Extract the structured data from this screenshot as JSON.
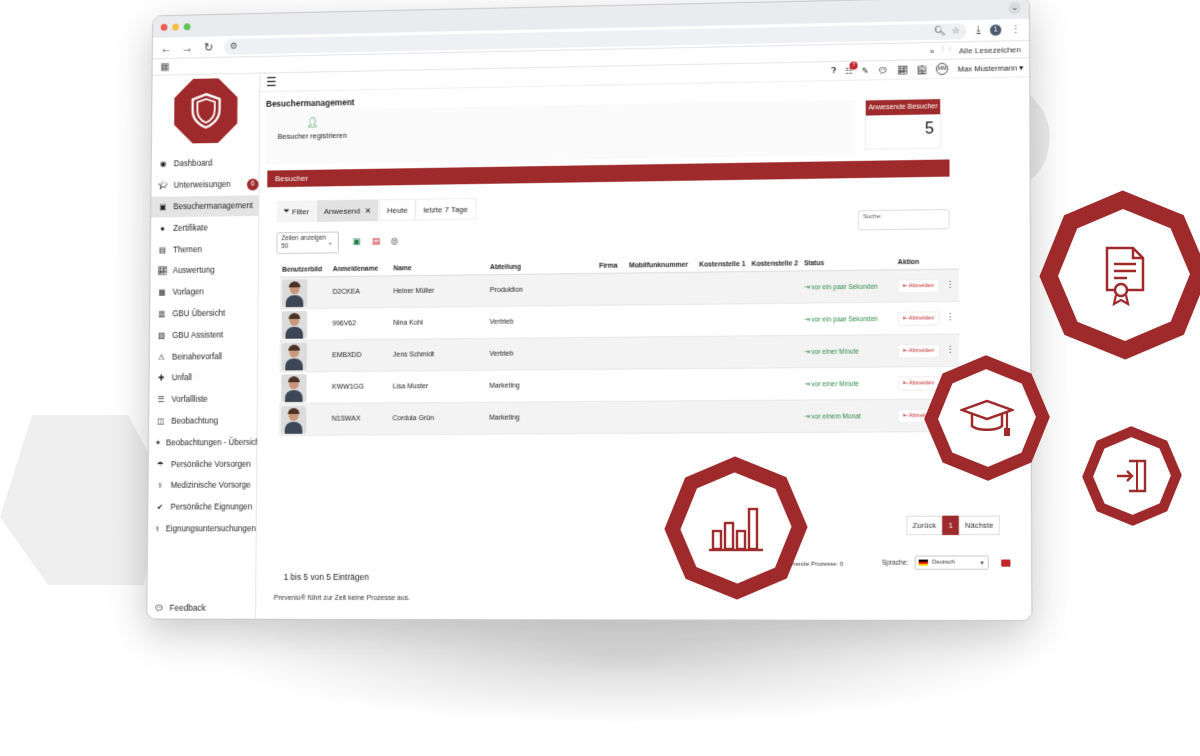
{
  "browser": {
    "bookmarks_label": "Alle Lesezeichen",
    "profile_initial": "1"
  },
  "topbar": {
    "notification_count": "7",
    "user_initials": "MM",
    "user_name": "Max Mustermann"
  },
  "sidebar": {
    "items": [
      {
        "label": "Dashboard",
        "icon": "dashboard-icon"
      },
      {
        "label": "Unterweisungen",
        "icon": "graduation-icon",
        "badge": "6"
      },
      {
        "label": "Besuchermanagement",
        "icon": "visitor-icon",
        "active": true
      },
      {
        "label": "Zertifikate",
        "icon": "certificate-icon"
      },
      {
        "label": "Themen",
        "icon": "topics-icon"
      },
      {
        "label": "Auswertung",
        "icon": "chart-icon"
      },
      {
        "label": "Vorlagen",
        "icon": "template-icon"
      },
      {
        "label": "GBU Übersicht",
        "icon": "gbu-overview-icon"
      },
      {
        "label": "GBU Assistent",
        "icon": "gbu-assistant-icon"
      },
      {
        "label": "Beinahevorfall",
        "icon": "near-miss-icon"
      },
      {
        "label": "Unfall",
        "icon": "accident-icon"
      },
      {
        "label": "Vorfallliste",
        "icon": "incident-list-icon"
      },
      {
        "label": "Beobachtung",
        "icon": "observation-icon"
      },
      {
        "label": "Beobachtungen - Übersicht",
        "icon": "observation-overview-icon"
      },
      {
        "label": "Persönliche Vorsorgen",
        "icon": "personal-care-icon"
      },
      {
        "label": "Medizinische Vorsorge",
        "icon": "medical-icon"
      },
      {
        "label": "Persönliche Eignungen",
        "icon": "aptitude-icon"
      },
      {
        "label": "Eignungsuntersuchungen",
        "icon": "stethoscope-icon"
      }
    ],
    "feedback_label": "Feedback"
  },
  "page": {
    "title": "Besuchermanagement",
    "register_label": "Besucher registrieren",
    "present_label": "Anwesende Besucher",
    "present_count": "5",
    "section_label": "Besucher"
  },
  "filters": {
    "filter_label": "Filter",
    "options": [
      "Anwesend",
      "Heute",
      "letzte 7 Tage"
    ],
    "active": "Anwesend",
    "search_placeholder": "Suche:"
  },
  "rows_control": {
    "label": "Zeilen anzeigen",
    "value": "50"
  },
  "table": {
    "headers": [
      "Benutzerbild",
      "Anmeldename",
      "Name",
      "Abteilung",
      "Firma",
      "Mobilfunknummer",
      "Kostenstelle 1",
      "Kostenstelle 2",
      "Status",
      "Aktion"
    ],
    "rows": [
      {
        "login": "D2CKEA",
        "name": "Heiner Müller",
        "department": "Produktion",
        "status": "vor ein paar Sekunden",
        "action": "Abmelden"
      },
      {
        "login": "996V62",
        "name": "Nina Kohl",
        "department": "Vertrieb",
        "status": "vor ein paar Sekunden",
        "action": "Abmelden"
      },
      {
        "login": "EMBXDD",
        "name": "Jens Schmidt",
        "department": "Vertrieb",
        "status": "vor einer Minute",
        "action": "Abmelden"
      },
      {
        "login": "KWW1GG",
        "name": "Lisa Muster",
        "department": "Marketing",
        "status": "vor einer Minute",
        "action": "Abmelden"
      },
      {
        "login": "N1SWAX",
        "name": "Cordula Grün",
        "department": "Marketing",
        "status": "vor einem Monat",
        "action": "Abmelden"
      }
    ]
  },
  "pagination": {
    "prev": "Zurück",
    "current": "1",
    "next": "Nächste"
  },
  "footer": {
    "pending": "Ausstehende Prozesse: 0",
    "language_label": "Sprache:",
    "language_value": "Deutsch",
    "entries": "1 bis 5 von 5 Einträgen",
    "status_line": "Prevenio® führt zur Zeit keine Prozesse aus."
  },
  "colors": {
    "brand": "#9e2a2b",
    "status_green": "#2e8b4a"
  }
}
